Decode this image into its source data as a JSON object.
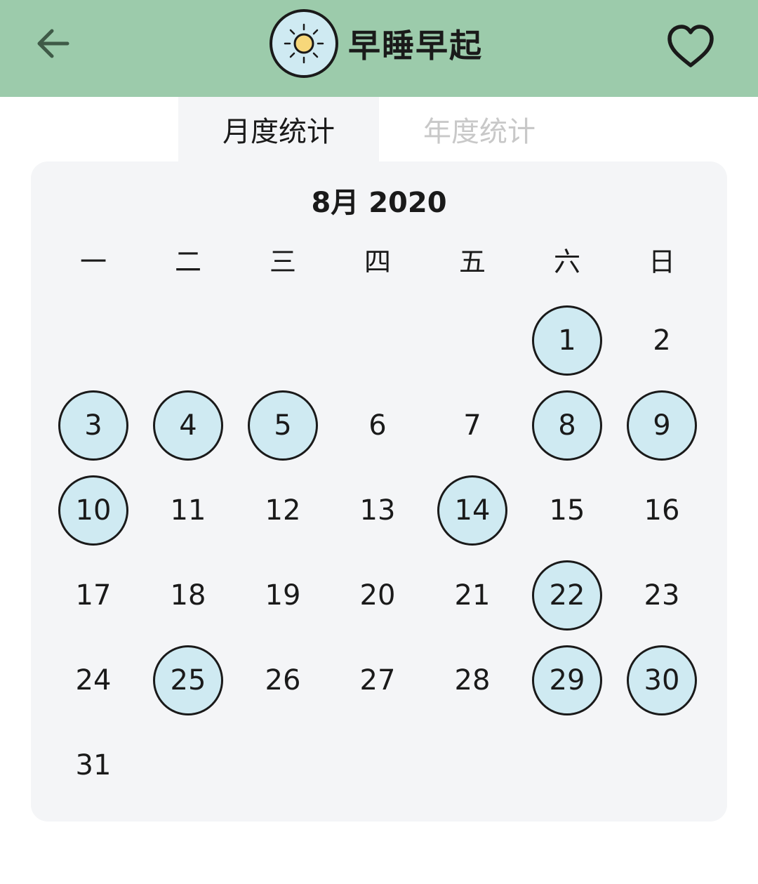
{
  "header": {
    "title": "早睡早起",
    "back_icon": "arrow-left-icon",
    "app_icon": "sun-icon",
    "favorite_icon": "heart-outline-icon",
    "bg_color": "#9ccbab"
  },
  "tabs": [
    {
      "label": "月度统计",
      "active": true
    },
    {
      "label": "年度统计",
      "active": false
    }
  ],
  "calendar": {
    "month_label": "8月 2020",
    "weekdays": [
      "一",
      "二",
      "三",
      "四",
      "五",
      "六",
      "日"
    ],
    "first_weekday_index": 5,
    "days_in_month": 31,
    "marked_days": [
      1,
      3,
      4,
      5,
      8,
      9,
      10,
      14,
      22,
      25,
      29,
      30
    ],
    "mark_color": "#cfeaf2"
  }
}
